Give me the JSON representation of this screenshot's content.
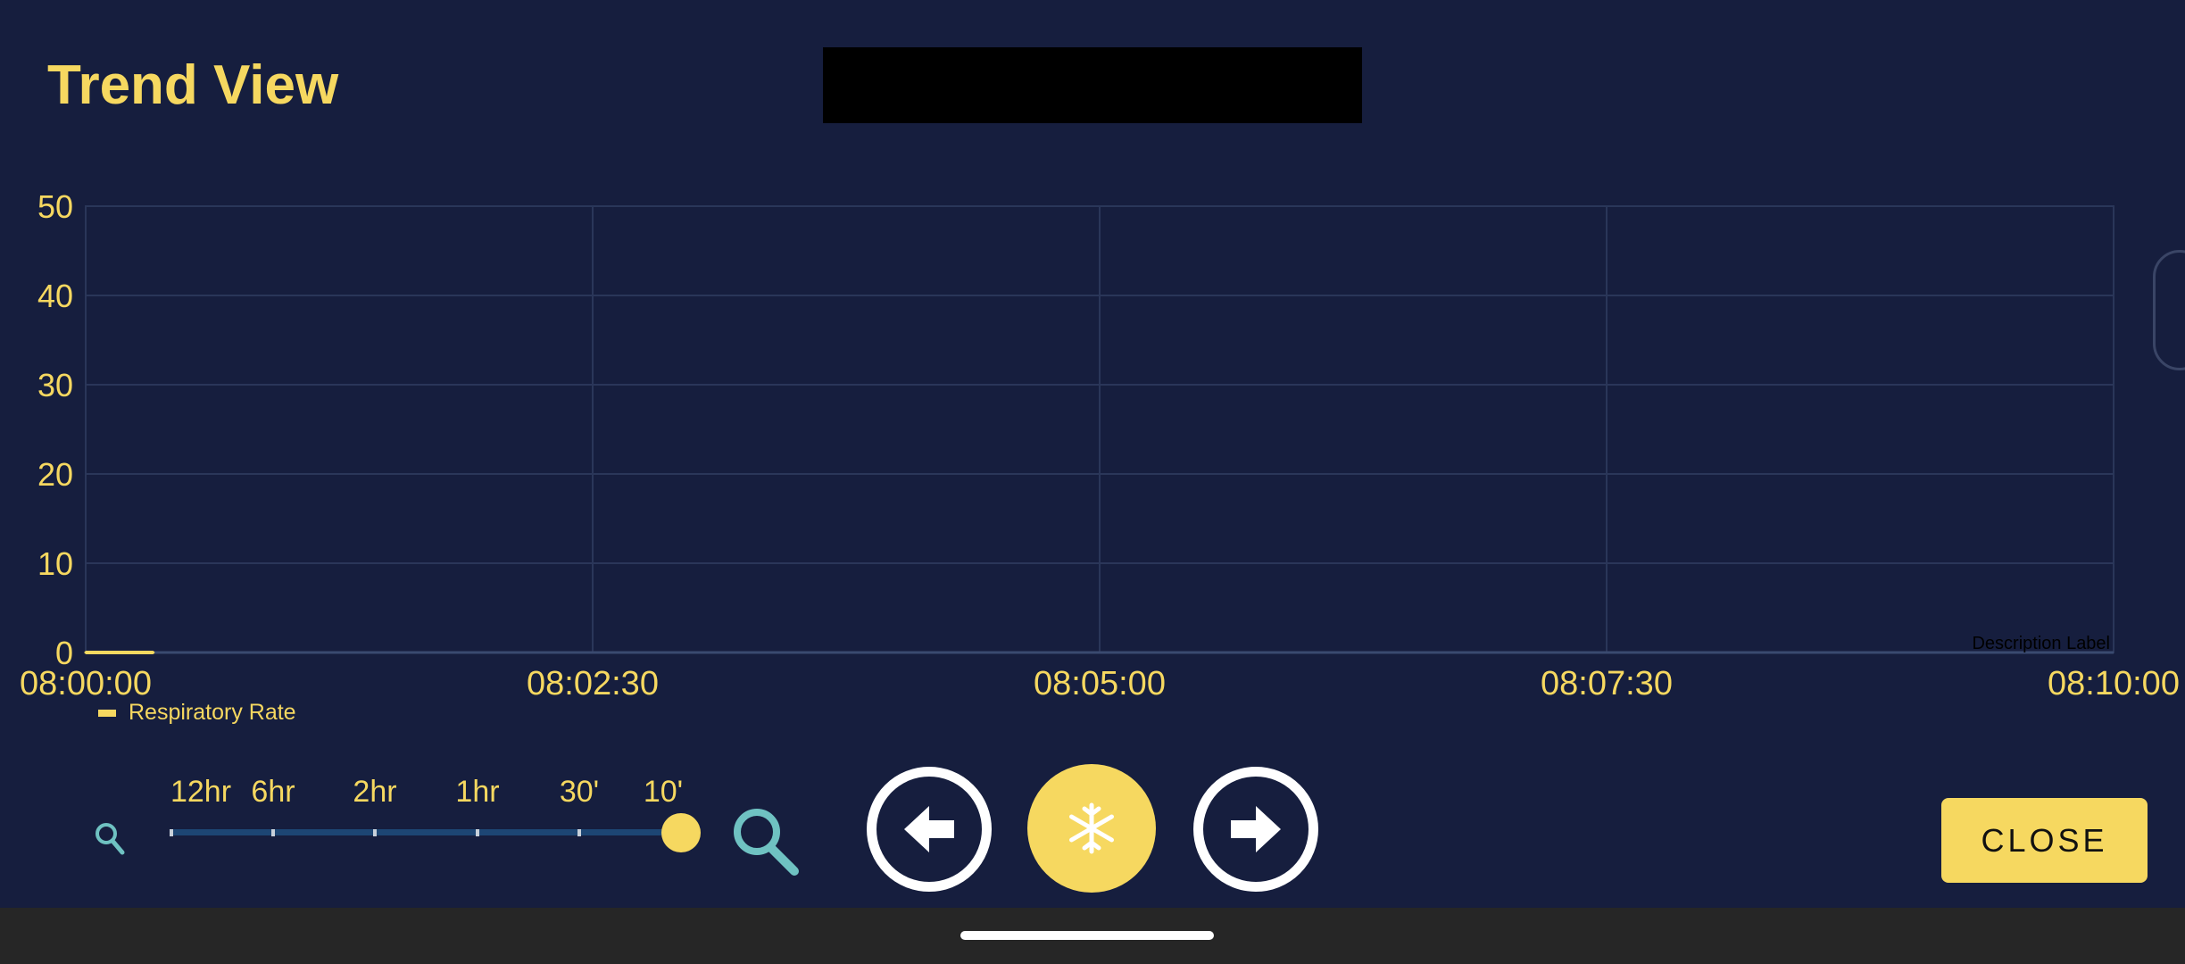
{
  "header": {
    "title": "Trend View"
  },
  "chart_data": {
    "type": "line",
    "x_ticks": [
      "08:00:00",
      "08:02:30",
      "08:05:00",
      "08:07:30",
      "08:10:00"
    ],
    "x_range": [
      "08:00:00",
      "08:10:00"
    ],
    "y_ticks": [
      0,
      10,
      20,
      30,
      40,
      50
    ],
    "ylim": [
      0,
      50
    ],
    "grid": true,
    "series": [
      {
        "name": "Respiratory Rate",
        "x": [
          "08:00:00",
          "08:00:10",
          "08:00:20"
        ],
        "values": [
          0,
          0,
          0
        ]
      }
    ],
    "description_label": "Description Label",
    "legend_position": "bottom-left"
  },
  "legend": {
    "label": "Respiratory Rate"
  },
  "zoom_slider": {
    "labels": [
      "12hr",
      "6hr",
      "2hr",
      "1hr",
      "30'",
      "10'"
    ],
    "selected": "10'"
  },
  "controls": {
    "prev_icon": "arrow-left-icon",
    "freeze_icon": "snowflake-icon",
    "next_icon": "arrow-right-icon",
    "zoom_out_icon": "magnifier-small-icon",
    "zoom_in_icon": "magnifier-large-icon",
    "close_label": "CLOSE"
  },
  "colors": {
    "background": "#161e3e",
    "accent": "#f6d860",
    "zoom_icon": "#6fc2c2",
    "grid": "#2a3659"
  }
}
